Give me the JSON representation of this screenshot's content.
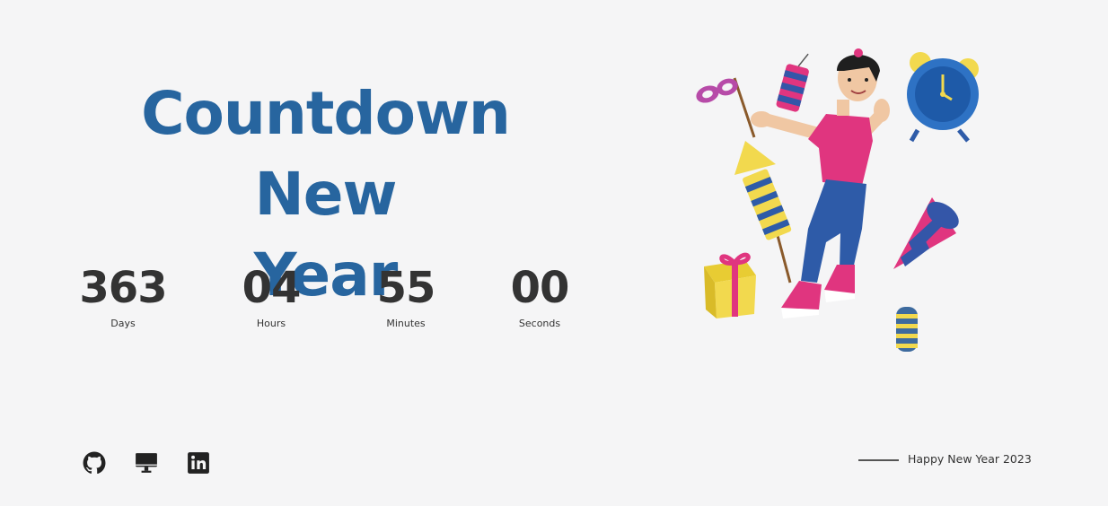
{
  "hero": {
    "title_line1": "Countdown New",
    "title_line2": "Year"
  },
  "countdown": [
    {
      "value": "363",
      "label": "Days"
    },
    {
      "value": "04",
      "label": "Hours"
    },
    {
      "value": "55",
      "label": "Minutes"
    },
    {
      "value": "00",
      "label": "Seconds"
    }
  ],
  "social": [
    {
      "icon": "github-icon"
    },
    {
      "icon": "monitor-icon"
    },
    {
      "icon": "linkedin-icon"
    }
  ],
  "footer": {
    "text": "Happy New Year 2023"
  },
  "colors": {
    "title": "#27659f",
    "digits": "#333333",
    "background": "#f5f5f6",
    "accent_pink": "#e0357f",
    "accent_yellow": "#f2d94e"
  }
}
